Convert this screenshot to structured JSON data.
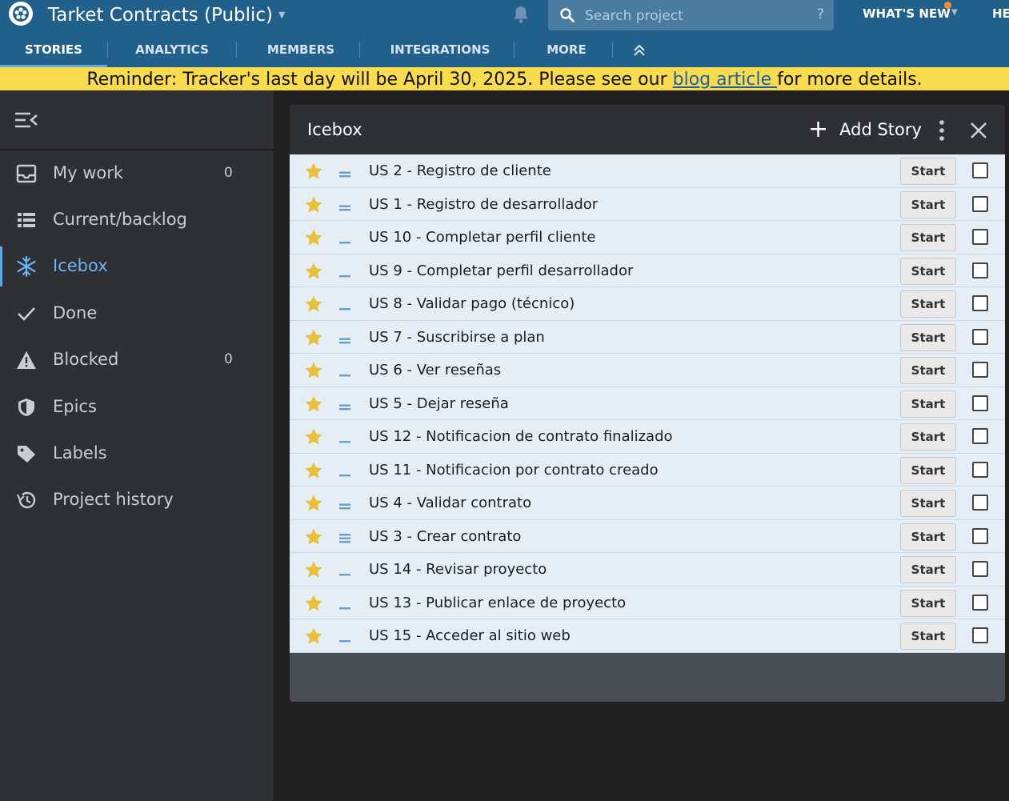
{
  "header": {
    "project_name": "Tarket Contracts (Public)",
    "search_placeholder": "Search project",
    "search_help": "?",
    "whats_new": "WHAT'S NEW",
    "help_truncated": "HE"
  },
  "tabs": [
    {
      "label": "STORIES",
      "active": true
    },
    {
      "label": "ANALYTICS",
      "active": false
    },
    {
      "label": "MEMBERS",
      "active": false
    },
    {
      "label": "INTEGRATIONS",
      "active": false
    },
    {
      "label": "MORE",
      "active": false
    }
  ],
  "banner": {
    "before": "Reminder: Tracker's last day will be April 30, 2025. Please see our ",
    "link": "blog article ",
    "after": "for more details."
  },
  "sidebar": {
    "items": [
      {
        "label": "My work",
        "count": "0",
        "icon": "inbox-icon"
      },
      {
        "label": "Current/backlog",
        "count": "",
        "icon": "list-icon"
      },
      {
        "label": "Icebox",
        "count": "",
        "icon": "snowflake-icon",
        "active": true
      },
      {
        "label": "Done",
        "count": "",
        "icon": "check-icon"
      },
      {
        "label": "Blocked",
        "count": "0",
        "icon": "warning-icon"
      },
      {
        "label": "Epics",
        "count": "",
        "icon": "shield-icon"
      },
      {
        "label": "Labels",
        "count": "",
        "icon": "tag-icon"
      },
      {
        "label": "Project history",
        "count": "",
        "icon": "history-icon"
      }
    ]
  },
  "panel": {
    "title": "Icebox",
    "add_story": "Add Story",
    "start_label": "Start",
    "stories": [
      {
        "title": "US 2 - Registro de cliente",
        "estimate": 2
      },
      {
        "title": "US 1 - Registro de desarrollador",
        "estimate": 2
      },
      {
        "title": "US 10 - Completar perfil cliente",
        "estimate": 1
      },
      {
        "title": "US 9 - Completar perfil desarrollador",
        "estimate": 1
      },
      {
        "title": "US 8 - Validar pago (técnico)",
        "estimate": 1
      },
      {
        "title": "US 7 - Suscribirse a plan",
        "estimate": 2
      },
      {
        "title": "US 6 - Ver reseñas",
        "estimate": 1
      },
      {
        "title": "US 5 - Dejar reseña",
        "estimate": 2
      },
      {
        "title": "US 12 - Notificacion de contrato finalizado",
        "estimate": 1
      },
      {
        "title": "US 11 - Notificacion por contrato creado",
        "estimate": 1
      },
      {
        "title": "US 4 - Validar contrato",
        "estimate": 2
      },
      {
        "title": "US 3 - Crear contrato",
        "estimate": 3
      },
      {
        "title": "US 14 - Revisar proyecto",
        "estimate": 1
      },
      {
        "title": "US 13 - Publicar enlace de proyecto",
        "estimate": 1
      },
      {
        "title": "US 15 - Acceder al sitio web",
        "estimate": 1
      }
    ]
  },
  "colors": {
    "header": "#22608c",
    "banner": "#f9dc4e",
    "active_accent": "#6cb3ef",
    "story_bg": "#e5edf5",
    "star": "#e8c03a"
  }
}
